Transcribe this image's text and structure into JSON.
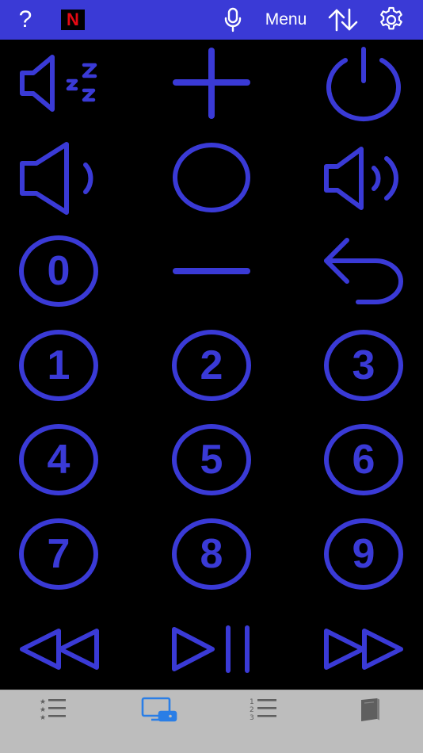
{
  "header": {
    "help_label": "?",
    "menu_label": "Menu",
    "icons": [
      "help-icon",
      "netflix-icon",
      "microphone-icon",
      "sort-arrows-icon",
      "gear-icon"
    ],
    "netflix_letter": "N"
  },
  "remote": {
    "buttons": [
      "sleep-timer",
      "volume-up-plus",
      "power",
      "volume-down",
      "ok-select",
      "volume-up",
      "zero",
      "channel-minus",
      "back",
      "1",
      "2",
      "3",
      "4",
      "5",
      "6",
      "7",
      "8",
      "9",
      "rewind",
      "play-pause",
      "fast-forward"
    ],
    "digits": {
      "zero": "0",
      "one": "1",
      "two": "2",
      "three": "3",
      "four": "4",
      "five": "5",
      "six": "6",
      "seven": "7",
      "eight": "8",
      "nine": "9"
    }
  },
  "tabbar": {
    "tabs": [
      {
        "id": "favorites",
        "icon": "starred-list-icon",
        "selected": false
      },
      {
        "id": "remote",
        "icon": "tv-remote-icon",
        "selected": true
      },
      {
        "id": "channels",
        "icon": "numbered-list-icon",
        "selected": false
      },
      {
        "id": "guide",
        "icon": "book-icon",
        "selected": false
      }
    ]
  },
  "colors": {
    "accent": "#3a3ad6",
    "topbar_bg": "#3a3ad6",
    "background": "#000000",
    "tabbar_bg": "#bdbdbd",
    "tab_selected": "#2a7ee6",
    "tab_unselected": "#5f5f5f",
    "netflix_red": "#e50914"
  }
}
